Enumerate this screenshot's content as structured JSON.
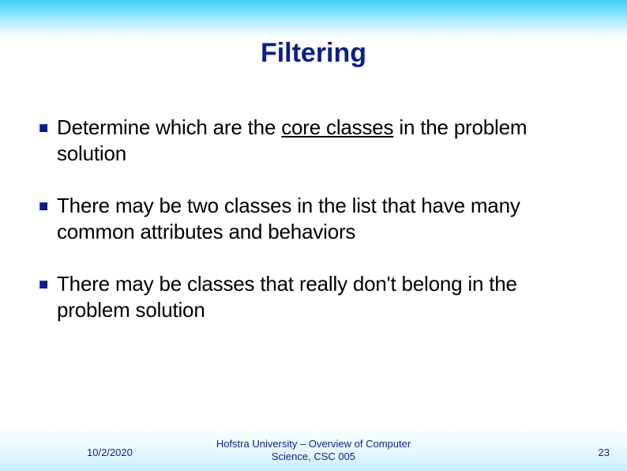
{
  "slide": {
    "title": "Filtering",
    "bullets": [
      {
        "prefix": "Determine which are the ",
        "underlined": "core classes",
        "suffix": " in the problem solution"
      },
      {
        "prefix": "There may be two classes in the list that have many common attributes and behaviors",
        "underlined": "",
        "suffix": ""
      },
      {
        "prefix": "There may be classes that really don't belong in the problem solution",
        "underlined": "",
        "suffix": ""
      }
    ]
  },
  "footer": {
    "date": "10/2/2020",
    "center": "Hofstra University – Overview of Computer Science, CSC 005",
    "page": "23"
  }
}
